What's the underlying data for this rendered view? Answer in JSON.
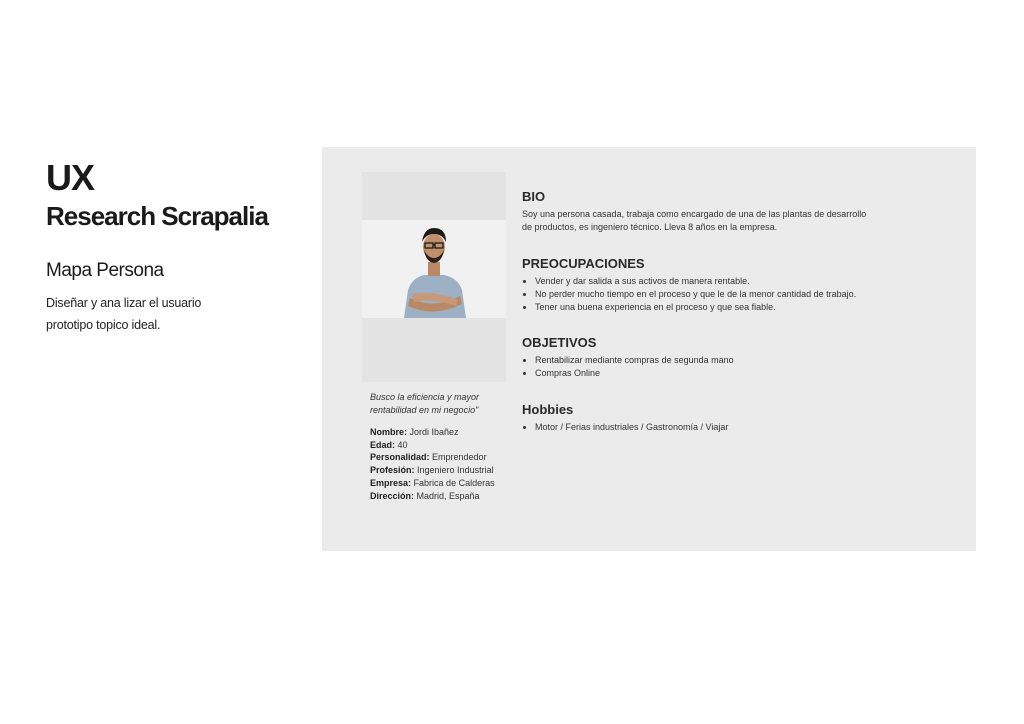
{
  "header": {
    "title_line1": "UX",
    "title_line2": "Research Scrapalia",
    "subtitle": "Mapa Persona",
    "description_line1": "Diseñar y ana lizar el usuario",
    "description_line2": "prototipo topico ideal."
  },
  "persona": {
    "quote_line1": "Busco la eficiencia y mayor",
    "quote_line2": "rentabilidad en mi negocio\"",
    "facts": [
      {
        "label": "Nombre:",
        "value": "Jordi Ibañez"
      },
      {
        "label": "Edad:",
        "value": "40"
      },
      {
        "label": "Personalidad:",
        "value": "Emprendedor"
      },
      {
        "label": "Profesión:",
        "value": "Ingeniero Industrial"
      },
      {
        "label": "Empresa:",
        "value": "Fabrica de Calderas"
      },
      {
        "label": "Dirección:",
        "value": "Madrid, España"
      }
    ]
  },
  "sections": {
    "bio": {
      "title": "BIO",
      "line1": "Soy una persona casada, trabaja como encargado de una de las plantas de desarrollo",
      "line2": "de productos, es ingeniero técnico. Lleva 8 años en la empresa."
    },
    "preocupaciones": {
      "title": "PREOCUPACIONES",
      "items": [
        "Vender y dar salida a sus activos de manera rentable.",
        "No perder mucho tiempo en el proceso y que le de la menor cantidad de trabajo.",
        "Tener una buena experiencia en el proceso y que sea fiable."
      ]
    },
    "objetivos": {
      "title": "OBJETIVOS",
      "items": [
        "Rentabilizar mediante compras de segunda mano",
        "Compras Online"
      ]
    },
    "hobbies": {
      "title": "Hobbies",
      "items": [
        "Motor / Ferias industriales / Gastronomía / Viajar"
      ]
    }
  }
}
